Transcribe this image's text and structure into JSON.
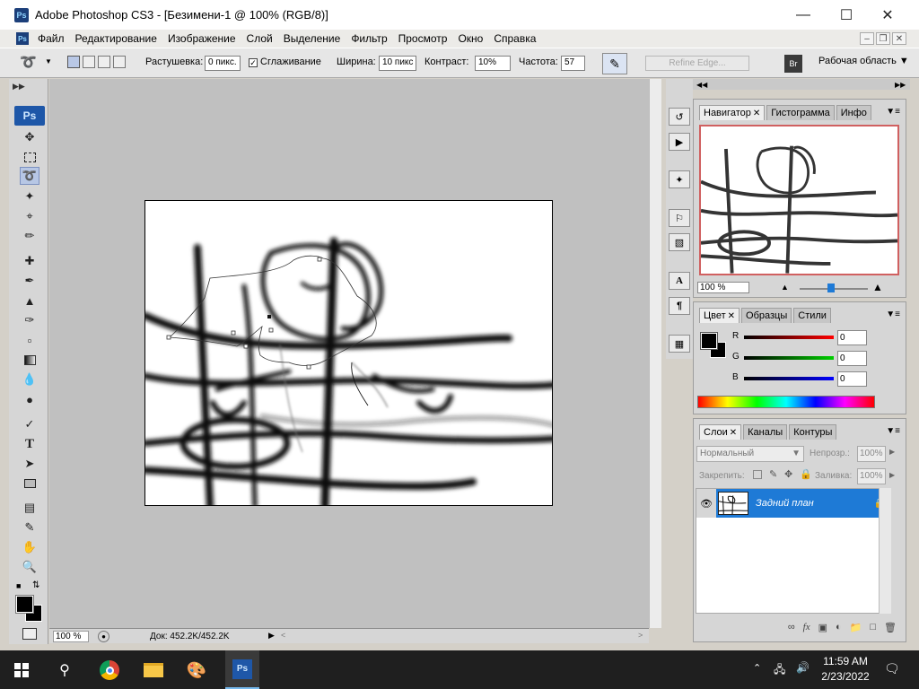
{
  "window": {
    "title": "Adobe Photoshop CS3 - [Безимени-1 @ 100% (RGB/8)]",
    "app_icon": "Ps"
  },
  "menu": [
    "Файл",
    "Редактирование",
    "Изображение",
    "Слой",
    "Выделение",
    "Фильтр",
    "Просмотр",
    "Окно",
    "Справка"
  ],
  "options": {
    "feather_label": "Растушевка:",
    "feather_value": "0 пикс.",
    "antialias_label": "Сглаживание",
    "width_label": "Ширина:",
    "width_value": "10 пикс",
    "contrast_label": "Контраст:",
    "contrast_value": "10%",
    "frequency_label": "Частота:",
    "frequency_value": "57",
    "refine_edge": "Refine Edge...",
    "workspace": "Рабочая область"
  },
  "status": {
    "zoom": "100 %",
    "doc": "Док: 452.2K/452.2K"
  },
  "navigator": {
    "tabs": [
      "Навигатор",
      "Гистограмма",
      "Инфо"
    ],
    "zoom": "100 %"
  },
  "color": {
    "tabs": [
      "Цвет",
      "Образцы",
      "Стили"
    ],
    "r_label": "R",
    "g_label": "G",
    "b_label": "B",
    "r": "0",
    "g": "0",
    "b": "0"
  },
  "layers": {
    "tabs": [
      "Слои",
      "Каналы",
      "Контуры"
    ],
    "blend_mode": "Нормальный",
    "opacity_label": "Непрозр.:",
    "opacity": "100%",
    "lock_label": "Закрепить:",
    "fill_label": "Заливка:",
    "fill": "100%",
    "layer_name": "Задний план"
  },
  "taskbar": {
    "time": "11:59 AM",
    "date": "2/23/2022",
    "ps_label": "Ps"
  },
  "colors": {
    "accent_blue": "#1e7ad6",
    "ps_blue": "#1e57a8",
    "nav_frame": "#d06060"
  }
}
